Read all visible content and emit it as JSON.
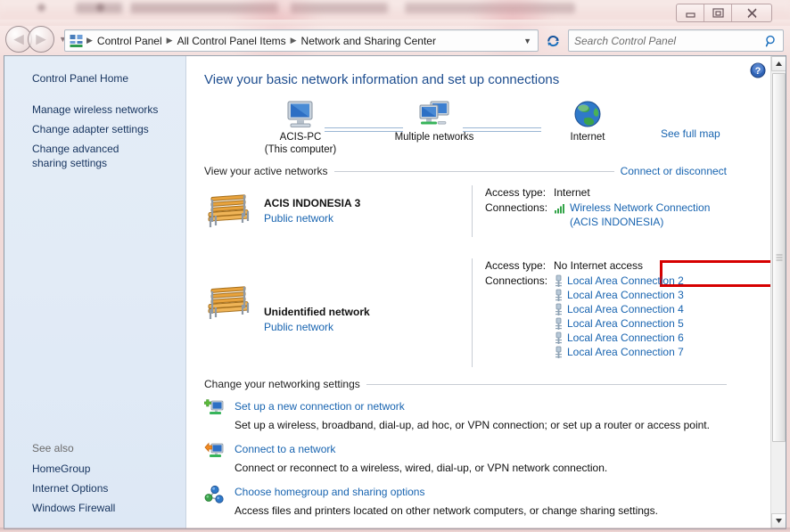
{
  "window": {
    "controls": {
      "minimize": "Minimize",
      "restore": "Restore",
      "close": "Close"
    }
  },
  "toolbar": {
    "back_label": "Back",
    "forward_label": "Forward",
    "recent_pages_label": "Recent pages",
    "breadcrumbs": [
      "Control Panel",
      "All Control Panel Items",
      "Network and Sharing Center"
    ],
    "address_dropdown_label": "Previous locations",
    "refresh_label": "Refresh",
    "search": {
      "placeholder": "Search Control Panel",
      "value": ""
    }
  },
  "sidebar": {
    "home_label": "Control Panel Home",
    "items": [
      {
        "label": "Manage wireless networks"
      },
      {
        "label": "Change adapter settings"
      },
      {
        "label": "Change advanced sharing settings"
      }
    ],
    "see_also": {
      "title": "See also",
      "items": [
        {
          "label": "HomeGroup"
        },
        {
          "label": "Internet Options"
        },
        {
          "label": "Windows Firewall"
        }
      ]
    }
  },
  "content": {
    "help_label": "Help",
    "title": "View your basic network information and set up connections",
    "map": {
      "nodes": [
        {
          "label": "ACIS-PC",
          "sublabel": "(This computer)",
          "icon": "computer-icon"
        },
        {
          "label": "Multiple networks",
          "sublabel": "",
          "icon": "multiple-networks-icon"
        },
        {
          "label": "Internet",
          "sublabel": "",
          "icon": "globe-icon"
        }
      ],
      "see_full_map": "See full map"
    },
    "active_networks": {
      "heading": "View your active networks",
      "action_link": "Connect or disconnect",
      "networks": [
        {
          "name": "ACIS INDONESIA  3",
          "type": "Public network",
          "icon": "park-bench-icon",
          "access_type_label": "Access type:",
          "access_type_value": "Internet",
          "connections_label": "Connections:",
          "connections": [
            {
              "label": "Wireless Network Connection",
              "sublabel": "(ACIS INDONESIA)",
              "icon": "wifi-signal-icon"
            }
          ],
          "highlighted": true
        },
        {
          "name": "Unidentified network",
          "type": "Public network",
          "icon": "park-bench-icon",
          "access_type_label": "Access type:",
          "access_type_value": "No Internet access",
          "connections_label": "Connections:",
          "connections": [
            {
              "label": "Local Area Connection 2",
              "sublabel": "",
              "icon": "lan-icon"
            },
            {
              "label": "Local Area Connection 3",
              "sublabel": "",
              "icon": "lan-icon"
            },
            {
              "label": "Local Area Connection 4",
              "sublabel": "",
              "icon": "lan-icon"
            },
            {
              "label": "Local Area Connection 5",
              "sublabel": "",
              "icon": "lan-icon"
            },
            {
              "label": "Local Area Connection 6",
              "sublabel": "",
              "icon": "lan-icon"
            },
            {
              "label": "Local Area Connection 7",
              "sublabel": "",
              "icon": "lan-icon"
            }
          ],
          "highlighted": false
        }
      ]
    },
    "settings": {
      "heading": "Change your networking settings",
      "tasks": [
        {
          "link": "Set up a new connection or network",
          "description": "Set up a wireless, broadband, dial-up, ad hoc, or VPN connection; or set up a router or access point.",
          "icon": "new-connection-icon"
        },
        {
          "link": "Connect to a network",
          "description": "Connect or reconnect to a wireless, wired, dial-up, or VPN network connection.",
          "icon": "connect-network-icon"
        },
        {
          "link": "Choose homegroup and sharing options",
          "description": "Access files and printers located on other network computers, or change sharing settings.",
          "icon": "homegroup-icon"
        }
      ]
    }
  },
  "colors": {
    "accent_link": "#1864b0",
    "title_blue": "#1d4d8f",
    "highlight_red": "#d60000",
    "sidebar_bg": "#e2ebf6"
  }
}
